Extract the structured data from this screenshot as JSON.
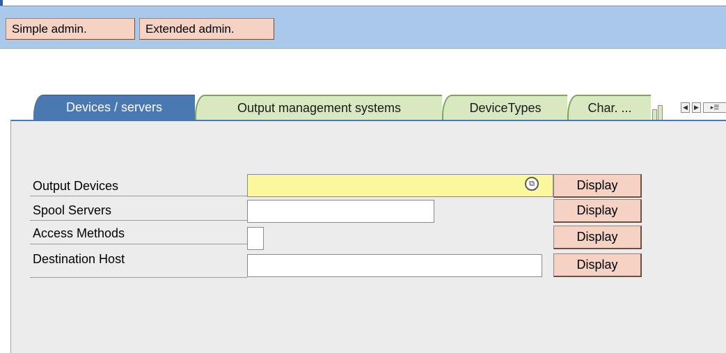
{
  "toolbar": {
    "simple_admin": "Simple admin.",
    "extended_admin": "Extended admin."
  },
  "tabs": [
    {
      "label": "Devices / servers",
      "active": true
    },
    {
      "label": "Output management systems",
      "active": false
    },
    {
      "label": "DeviceTypes",
      "active": false
    },
    {
      "label": "Char. ...",
      "active": false
    }
  ],
  "tab_nav": {
    "prev_icon": "triangle-left-icon",
    "next_icon": "triangle-right-icon",
    "list_icon": "tab-list-icon"
  },
  "rows": [
    {
      "label": "Output Devices",
      "value": "",
      "button": "Display"
    },
    {
      "label": "Spool Servers",
      "value": "",
      "button": "Display"
    },
    {
      "label": "Access Methods",
      "value": "",
      "button": "Display"
    },
    {
      "label": "Destination Host",
      "value": "",
      "button": "Display"
    }
  ],
  "colors": {
    "toolbar_bg": "#a9c8ea",
    "button_bg": "#f5d2c3",
    "active_tab": "#4a78b0",
    "inactive_tab": "#d8e8c0",
    "required_field": "#fbf79c"
  }
}
